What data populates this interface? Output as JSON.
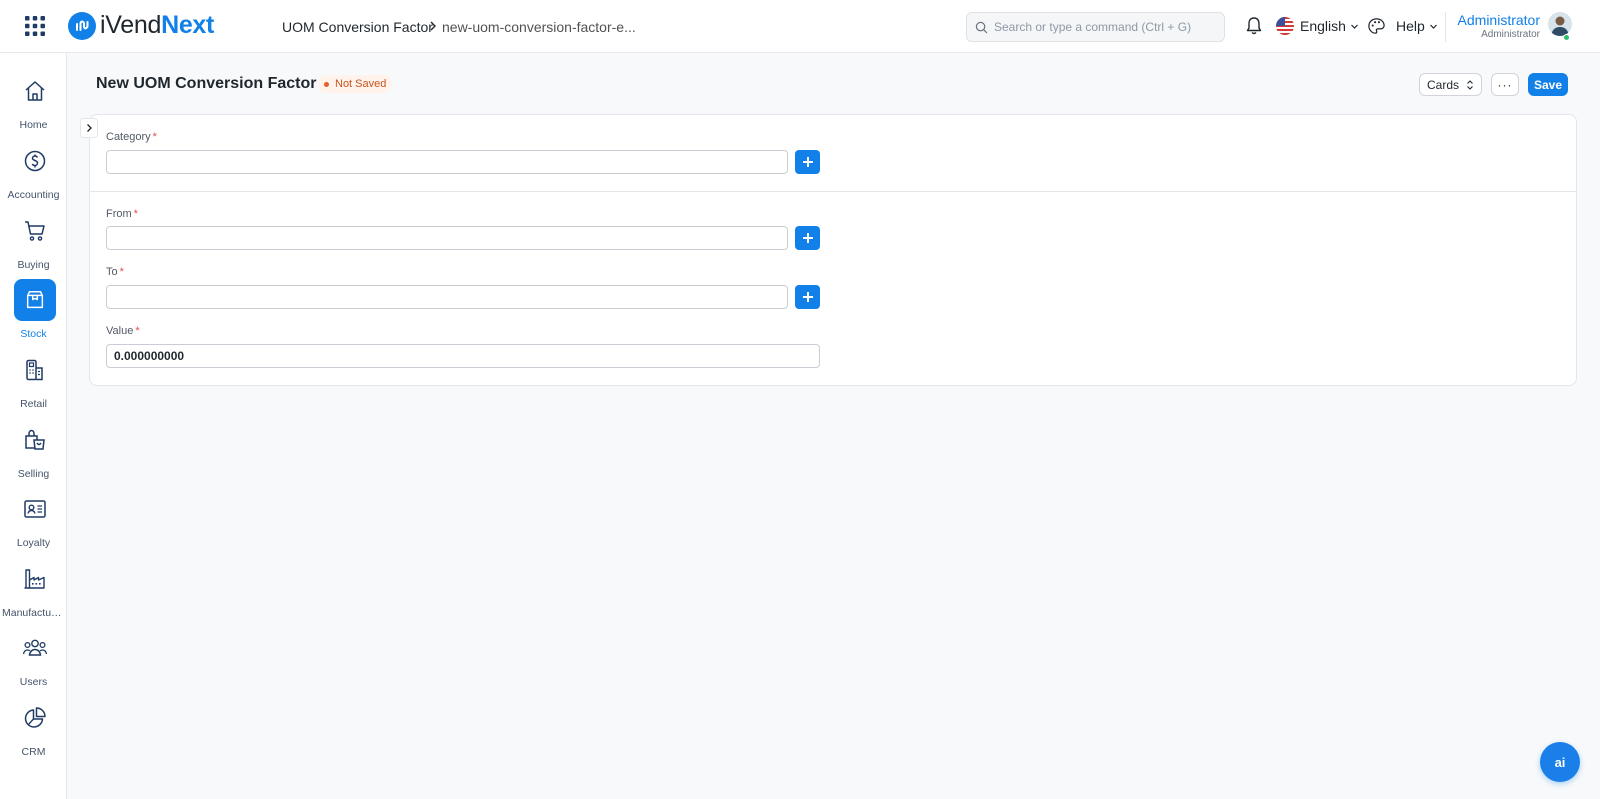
{
  "header": {
    "logo": {
      "part1": "iVend",
      "part2": "Next"
    },
    "breadcrumb": {
      "parent": "UOM Conversion Factor",
      "current": "new-uom-conversion-factor-e..."
    },
    "search": {
      "placeholder": "Search or type a command (Ctrl + G)"
    },
    "language": "English",
    "help_label": "Help",
    "user": {
      "name": "Administrator",
      "role": "Administrator"
    }
  },
  "sidebar": {
    "items": [
      {
        "label": "Home",
        "icon": "home-icon"
      },
      {
        "label": "Accounting",
        "icon": "dollar-icon"
      },
      {
        "label": "Buying",
        "icon": "cart-icon"
      },
      {
        "label": "Stock",
        "icon": "box-icon",
        "active": true
      },
      {
        "label": "Retail",
        "icon": "pos-icon"
      },
      {
        "label": "Selling",
        "icon": "shopping-bag-icon"
      },
      {
        "label": "Loyalty",
        "icon": "id-card-icon"
      },
      {
        "label": "Manufacturing",
        "icon": "factory-icon"
      },
      {
        "label": "Users",
        "icon": "users-icon"
      },
      {
        "label": "CRM",
        "icon": "pie-chart-icon"
      }
    ]
  },
  "page": {
    "title": "New UOM Conversion Factor",
    "status": "Not Saved",
    "view_label": "Cards",
    "more_label": "···",
    "save_label": "Save"
  },
  "form": {
    "category": {
      "label": "Category",
      "value": ""
    },
    "from": {
      "label": "From",
      "value": ""
    },
    "to": {
      "label": "To",
      "value": ""
    },
    "value": {
      "label": "Value",
      "value": "0.000000000"
    }
  },
  "fab": {
    "label": "ai"
  },
  "colors": {
    "accent": "#1180e8",
    "status": "#c5561f",
    "required": "#e24c4c"
  }
}
